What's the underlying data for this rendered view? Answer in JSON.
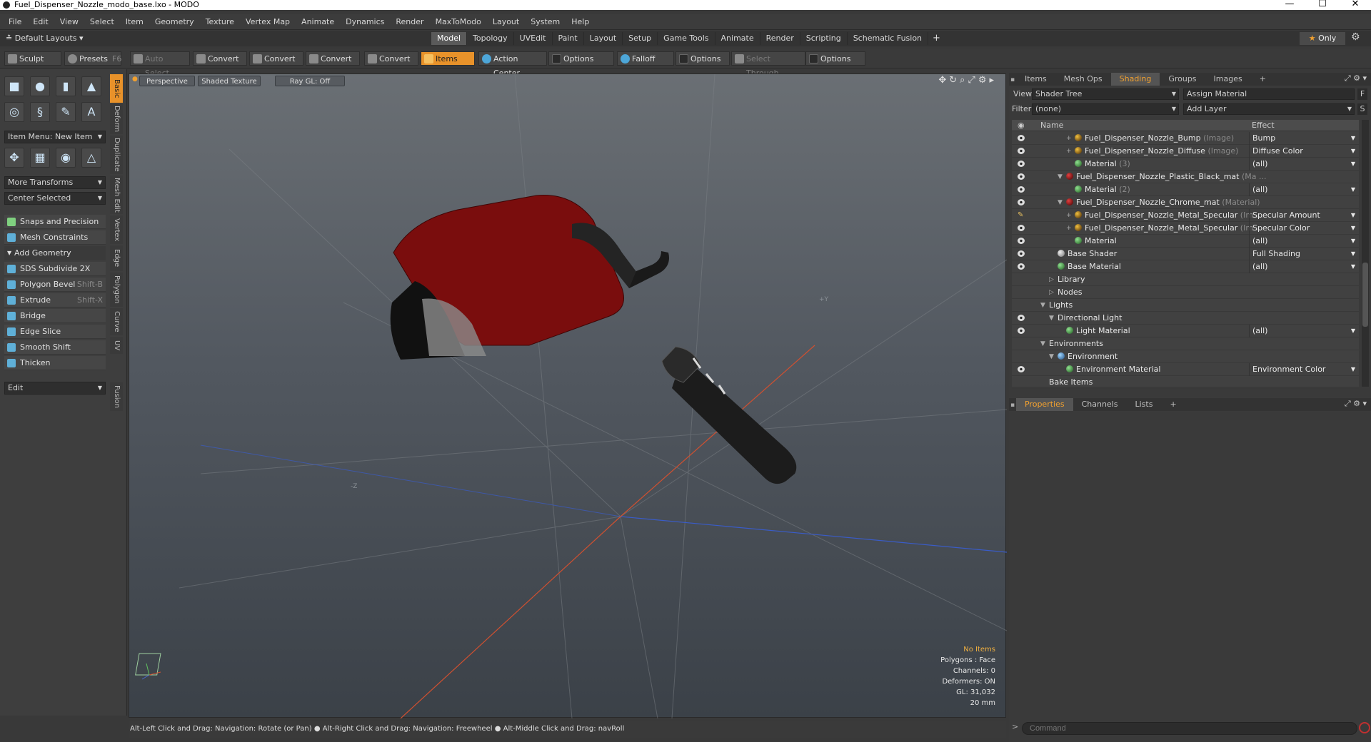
{
  "window": {
    "title": "Fuel_Dispenser_Nozzle_modo_base.lxo - MODO"
  },
  "menu": [
    "File",
    "Edit",
    "View",
    "Select",
    "Item",
    "Geometry",
    "Texture",
    "Vertex Map",
    "Animate",
    "Dynamics",
    "Render",
    "MaxToModo",
    "Layout",
    "System",
    "Help"
  ],
  "layouts": {
    "default": "Default Layouts",
    "tabs": [
      "Model",
      "Topology",
      "UVEdit",
      "Paint",
      "Layout",
      "Setup",
      "Game Tools",
      "Animate",
      "Render",
      "Scripting",
      "Schematic Fusion"
    ],
    "active": "Model",
    "only": "Only"
  },
  "toolbar": {
    "sculpt": "Sculpt",
    "presets": "Presets",
    "presets_key": "F6",
    "auto_select": "Auto Select",
    "convert": "Convert",
    "items": "Items",
    "action_center": "Action Center",
    "options": "Options",
    "falloff": "Falloff",
    "select_through": "Select Through"
  },
  "left": {
    "vtabs": [
      "Basic",
      "Deform",
      "Duplicate",
      "Mesh Edit",
      "Vertex",
      "Edge",
      "Polygon",
      "Curve",
      "UV",
      "Fusion"
    ],
    "item_menu": "Item Menu: New Item",
    "more_transforms": "More Transforms",
    "center_selected": "Center Selected",
    "snaps": "Snaps and Precision",
    "mesh_constraints": "Mesh Constraints",
    "add_geometry": "Add Geometry",
    "tools": [
      {
        "label": "SDS Subdivide 2X",
        "key": ""
      },
      {
        "label": "Polygon Bevel",
        "key": "Shift-B"
      },
      {
        "label": "Extrude",
        "key": "Shift-X"
      },
      {
        "label": "Bridge",
        "key": ""
      },
      {
        "label": "Edge Slice",
        "key": ""
      },
      {
        "label": "Smooth Shift",
        "key": ""
      },
      {
        "label": "Thicken",
        "key": ""
      }
    ],
    "edit": "Edit"
  },
  "viewport": {
    "perspective": "Perspective",
    "shading": "Shaded Texture",
    "raygl": "Ray GL: Off",
    "info": {
      "no_items": "No Items",
      "polygons": "Polygons : Face",
      "channels": "Channels: 0",
      "deformers": "Deformers: ON",
      "gl": "GL: 31,032",
      "scale": "20 mm"
    },
    "axis_y": "+Y",
    "axis_z": "-Z"
  },
  "status": "Alt-Left Click and Drag: Navigation: Rotate (or Pan) ● Alt-Right Click and Drag: Navigation: Freewheel ● Alt-Middle Click and Drag: navRoll",
  "right": {
    "tabs": [
      "Items",
      "Mesh Ops",
      "Shading",
      "Groups",
      "Images"
    ],
    "active_tab": "Shading",
    "view_label": "View",
    "view_value": "Shader Tree",
    "assign": "Assign Material",
    "filter_label": "Filter",
    "filter_value": "(none)",
    "add_layer": "Add Layer",
    "col_name": "Name",
    "col_effect": "Effect",
    "rows": [
      {
        "name": "Fuel_Dispenser_Nozzle_Bump",
        "type": "(Image)",
        "effect": "Bump",
        "ball": "img",
        "indent": 4,
        "eye": true,
        "exp": "+"
      },
      {
        "name": "Fuel_Dispenser_Nozzle_Diffuse",
        "type": "(Image)",
        "effect": "Diffuse Color",
        "ball": "img",
        "indent": 4,
        "eye": true,
        "exp": "+"
      },
      {
        "name": "Material",
        "type": "(3)",
        "effect": "(all)",
        "ball": "grn",
        "indent": 4,
        "eye": true,
        "exp": ""
      },
      {
        "name": "Fuel_Dispenser_Nozzle_Plastic_Black_mat",
        "type": "(Ma ...",
        "effect": "",
        "ball": "mat",
        "indent": 3,
        "eye": true,
        "exp": "▼"
      },
      {
        "name": "Material",
        "type": "(2)",
        "effect": "(all)",
        "ball": "grn",
        "indent": 4,
        "eye": true,
        "exp": ""
      },
      {
        "name": "Fuel_Dispenser_Nozzle_Chrome_mat",
        "type": "(Material)",
        "effect": "",
        "ball": "mat",
        "indent": 3,
        "eye": true,
        "exp": "▼"
      },
      {
        "name": "Fuel_Dispenser_Nozzle_Metal_Specular",
        "type": "(Im ...",
        "effect": "Specular Amount",
        "ball": "img",
        "indent": 4,
        "eye": false,
        "exp": "+"
      },
      {
        "name": "Fuel_Dispenser_Nozzle_Metal_Specular",
        "type": "(Im ...",
        "effect": "Specular Color",
        "ball": "img",
        "indent": 4,
        "eye": true,
        "exp": "+"
      },
      {
        "name": "Material",
        "type": "",
        "effect": "(all)",
        "ball": "grn",
        "indent": 4,
        "eye": true,
        "exp": ""
      },
      {
        "name": "Base Shader",
        "type": "",
        "effect": "Full Shading",
        "ball": "gry",
        "indent": 2,
        "eye": true,
        "exp": ""
      },
      {
        "name": "Base Material",
        "type": "",
        "effect": "(all)",
        "ball": "grn",
        "indent": 2,
        "eye": true,
        "exp": ""
      },
      {
        "name": "Library",
        "type": "",
        "effect": "",
        "ball": "",
        "indent": 2,
        "eye": false,
        "exp": "▷"
      },
      {
        "name": "Nodes",
        "type": "",
        "effect": "",
        "ball": "",
        "indent": 2,
        "eye": false,
        "exp": "▷"
      },
      {
        "name": "Lights",
        "type": "",
        "effect": "",
        "ball": "",
        "indent": 1,
        "eye": false,
        "exp": "▼"
      },
      {
        "name": "Directional Light",
        "type": "",
        "effect": "",
        "ball": "",
        "indent": 2,
        "eye": true,
        "exp": "▼"
      },
      {
        "name": "Light Material",
        "type": "",
        "effect": "(all)",
        "ball": "grn",
        "indent": 3,
        "eye": true,
        "exp": ""
      },
      {
        "name": "Environments",
        "type": "",
        "effect": "",
        "ball": "",
        "indent": 1,
        "eye": false,
        "exp": "▼"
      },
      {
        "name": "Environment",
        "type": "",
        "effect": "",
        "ball": "env",
        "indent": 2,
        "eye": false,
        "exp": "▼"
      },
      {
        "name": "Environment Material",
        "type": "",
        "effect": "Environment Color",
        "ball": "grn",
        "indent": 3,
        "eye": true,
        "exp": ""
      },
      {
        "name": "Bake Items",
        "type": "",
        "effect": "",
        "ball": "",
        "indent": 1,
        "eye": false,
        "exp": ""
      }
    ],
    "props_tabs": [
      "Properties",
      "Channels",
      "Lists"
    ],
    "props_active": "Properties",
    "command_placeholder": "Command"
  },
  "colors": {
    "accent": "#e8922a",
    "nozzle_red": "#7a0d0d",
    "hose": "#1c1c1c"
  }
}
